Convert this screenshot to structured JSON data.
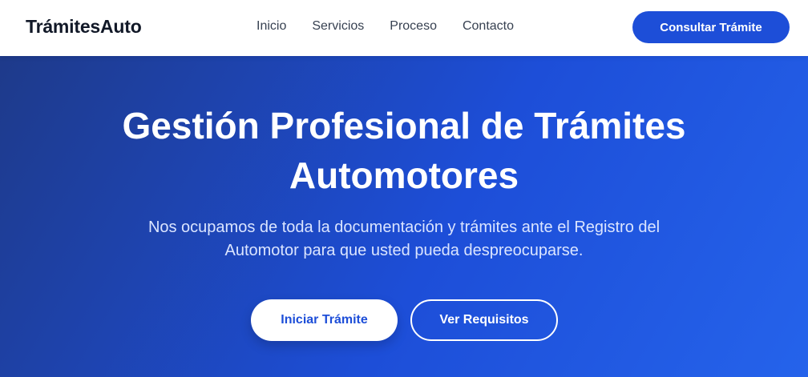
{
  "header": {
    "logo": "TrámitesAuto",
    "nav": [
      {
        "label": "Inicio"
      },
      {
        "label": "Servicios"
      },
      {
        "label": "Proceso"
      },
      {
        "label": "Contacto"
      }
    ],
    "cta_label": "Consultar Trámite"
  },
  "hero": {
    "title": "Gestión Profesional de Trámites Automotores",
    "subtitle": "Nos ocupamos de toda la documentación y trámites ante el Registro del Automotor para que usted pueda despreocuparse.",
    "primary_button": "Iniciar Trámite",
    "secondary_button": "Ver Requisitos"
  },
  "colors": {
    "accent": "#1d4ed8",
    "hero_gradient_start": "#1e3a8a",
    "hero_gradient_end": "#2563eb",
    "text_dark": "#111827"
  }
}
